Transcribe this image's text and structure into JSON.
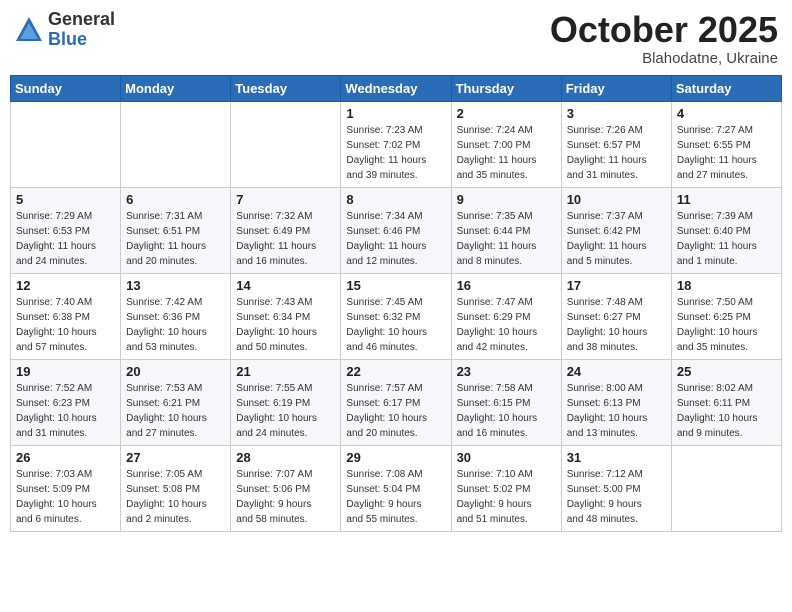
{
  "header": {
    "logo_general": "General",
    "logo_blue": "Blue",
    "month_title": "October 2025",
    "location": "Blahodatne, Ukraine"
  },
  "weekdays": [
    "Sunday",
    "Monday",
    "Tuesday",
    "Wednesday",
    "Thursday",
    "Friday",
    "Saturday"
  ],
  "weeks": [
    [
      {
        "day": "",
        "info": ""
      },
      {
        "day": "",
        "info": ""
      },
      {
        "day": "",
        "info": ""
      },
      {
        "day": "1",
        "info": "Sunrise: 7:23 AM\nSunset: 7:02 PM\nDaylight: 11 hours\nand 39 minutes."
      },
      {
        "day": "2",
        "info": "Sunrise: 7:24 AM\nSunset: 7:00 PM\nDaylight: 11 hours\nand 35 minutes."
      },
      {
        "day": "3",
        "info": "Sunrise: 7:26 AM\nSunset: 6:57 PM\nDaylight: 11 hours\nand 31 minutes."
      },
      {
        "day": "4",
        "info": "Sunrise: 7:27 AM\nSunset: 6:55 PM\nDaylight: 11 hours\nand 27 minutes."
      }
    ],
    [
      {
        "day": "5",
        "info": "Sunrise: 7:29 AM\nSunset: 6:53 PM\nDaylight: 11 hours\nand 24 minutes."
      },
      {
        "day": "6",
        "info": "Sunrise: 7:31 AM\nSunset: 6:51 PM\nDaylight: 11 hours\nand 20 minutes."
      },
      {
        "day": "7",
        "info": "Sunrise: 7:32 AM\nSunset: 6:49 PM\nDaylight: 11 hours\nand 16 minutes."
      },
      {
        "day": "8",
        "info": "Sunrise: 7:34 AM\nSunset: 6:46 PM\nDaylight: 11 hours\nand 12 minutes."
      },
      {
        "day": "9",
        "info": "Sunrise: 7:35 AM\nSunset: 6:44 PM\nDaylight: 11 hours\nand 8 minutes."
      },
      {
        "day": "10",
        "info": "Sunrise: 7:37 AM\nSunset: 6:42 PM\nDaylight: 11 hours\nand 5 minutes."
      },
      {
        "day": "11",
        "info": "Sunrise: 7:39 AM\nSunset: 6:40 PM\nDaylight: 11 hours\nand 1 minute."
      }
    ],
    [
      {
        "day": "12",
        "info": "Sunrise: 7:40 AM\nSunset: 6:38 PM\nDaylight: 10 hours\nand 57 minutes."
      },
      {
        "day": "13",
        "info": "Sunrise: 7:42 AM\nSunset: 6:36 PM\nDaylight: 10 hours\nand 53 minutes."
      },
      {
        "day": "14",
        "info": "Sunrise: 7:43 AM\nSunset: 6:34 PM\nDaylight: 10 hours\nand 50 minutes."
      },
      {
        "day": "15",
        "info": "Sunrise: 7:45 AM\nSunset: 6:32 PM\nDaylight: 10 hours\nand 46 minutes."
      },
      {
        "day": "16",
        "info": "Sunrise: 7:47 AM\nSunset: 6:29 PM\nDaylight: 10 hours\nand 42 minutes."
      },
      {
        "day": "17",
        "info": "Sunrise: 7:48 AM\nSunset: 6:27 PM\nDaylight: 10 hours\nand 38 minutes."
      },
      {
        "day": "18",
        "info": "Sunrise: 7:50 AM\nSunset: 6:25 PM\nDaylight: 10 hours\nand 35 minutes."
      }
    ],
    [
      {
        "day": "19",
        "info": "Sunrise: 7:52 AM\nSunset: 6:23 PM\nDaylight: 10 hours\nand 31 minutes."
      },
      {
        "day": "20",
        "info": "Sunrise: 7:53 AM\nSunset: 6:21 PM\nDaylight: 10 hours\nand 27 minutes."
      },
      {
        "day": "21",
        "info": "Sunrise: 7:55 AM\nSunset: 6:19 PM\nDaylight: 10 hours\nand 24 minutes."
      },
      {
        "day": "22",
        "info": "Sunrise: 7:57 AM\nSunset: 6:17 PM\nDaylight: 10 hours\nand 20 minutes."
      },
      {
        "day": "23",
        "info": "Sunrise: 7:58 AM\nSunset: 6:15 PM\nDaylight: 10 hours\nand 16 minutes."
      },
      {
        "day": "24",
        "info": "Sunrise: 8:00 AM\nSunset: 6:13 PM\nDaylight: 10 hours\nand 13 minutes."
      },
      {
        "day": "25",
        "info": "Sunrise: 8:02 AM\nSunset: 6:11 PM\nDaylight: 10 hours\nand 9 minutes."
      }
    ],
    [
      {
        "day": "26",
        "info": "Sunrise: 7:03 AM\nSunset: 5:09 PM\nDaylight: 10 hours\nand 6 minutes."
      },
      {
        "day": "27",
        "info": "Sunrise: 7:05 AM\nSunset: 5:08 PM\nDaylight: 10 hours\nand 2 minutes."
      },
      {
        "day": "28",
        "info": "Sunrise: 7:07 AM\nSunset: 5:06 PM\nDaylight: 9 hours\nand 58 minutes."
      },
      {
        "day": "29",
        "info": "Sunrise: 7:08 AM\nSunset: 5:04 PM\nDaylight: 9 hours\nand 55 minutes."
      },
      {
        "day": "30",
        "info": "Sunrise: 7:10 AM\nSunset: 5:02 PM\nDaylight: 9 hours\nand 51 minutes."
      },
      {
        "day": "31",
        "info": "Sunrise: 7:12 AM\nSunset: 5:00 PM\nDaylight: 9 hours\nand 48 minutes."
      },
      {
        "day": "",
        "info": ""
      }
    ]
  ]
}
